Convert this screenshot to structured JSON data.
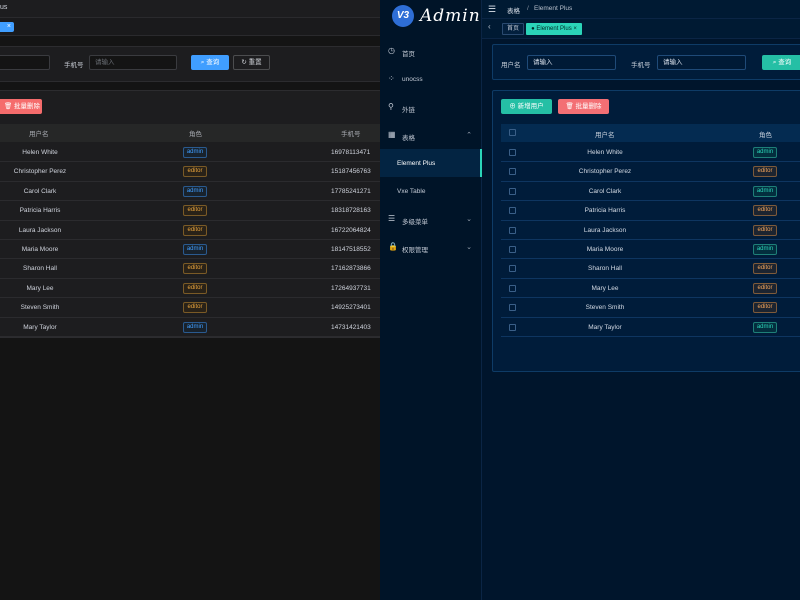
{
  "left": {
    "title_fragment": "us",
    "tag_close": "×",
    "search": {
      "phone_label": "手机号",
      "phone_placeholder": "请输入",
      "query_label": "查询",
      "reset_label": "重置"
    },
    "batch_delete_label": "批量删除",
    "columns": {
      "username": "用户名",
      "role": "角色",
      "phone": "手机号"
    }
  },
  "right": {
    "logo_mark": "V3",
    "logo_text": "Admin",
    "sidebar": {
      "items": [
        {
          "label": "首页",
          "icon": "home-icon"
        },
        {
          "label": "unocss",
          "icon": "unocss-icon"
        },
        {
          "label": "外链",
          "icon": "link-icon"
        },
        {
          "label": "表格",
          "icon": "grid-icon",
          "expanded": true
        },
        {
          "label": "Element Plus",
          "active": true
        },
        {
          "label": "Vxe Table"
        },
        {
          "label": "多级菜单",
          "icon": "menu-icon"
        },
        {
          "label": "权限管理",
          "icon": "lock-icon"
        }
      ]
    },
    "breadcrumb": {
      "parent": "表格",
      "separator": "/",
      "current": "Element Plus"
    },
    "tags": {
      "home": "首页",
      "active": "Element Plus"
    },
    "search": {
      "username_label": "用户名",
      "username_placeholder": "请输入",
      "phone_label": "手机号",
      "phone_placeholder": "请输入",
      "query_label": "查询"
    },
    "add_user_label": "新增用户",
    "batch_delete_label": "批量删除",
    "columns": {
      "username": "用户名",
      "role": "角色"
    }
  },
  "users": [
    {
      "name": "Helen White",
      "role": "admin",
      "phone": "16978113471"
    },
    {
      "name": "Christopher Perez",
      "role": "editor",
      "phone": "15187456763"
    },
    {
      "name": "Carol Clark",
      "role": "admin",
      "phone": "17785241271"
    },
    {
      "name": "Patricia Harris",
      "role": "editor",
      "phone": "18318728163"
    },
    {
      "name": "Laura Jackson",
      "role": "editor",
      "phone": "16722064824"
    },
    {
      "name": "Maria Moore",
      "role": "admin",
      "phone": "18147518552"
    },
    {
      "name": "Sharon Hall",
      "role": "editor",
      "phone": "17162873866"
    },
    {
      "name": "Mary Lee",
      "role": "editor",
      "phone": "17264937731"
    },
    {
      "name": "Steven Smith",
      "role": "editor",
      "phone": "14925273401"
    },
    {
      "name": "Mary Taylor",
      "role": "admin",
      "phone": "14731421403"
    }
  ]
}
